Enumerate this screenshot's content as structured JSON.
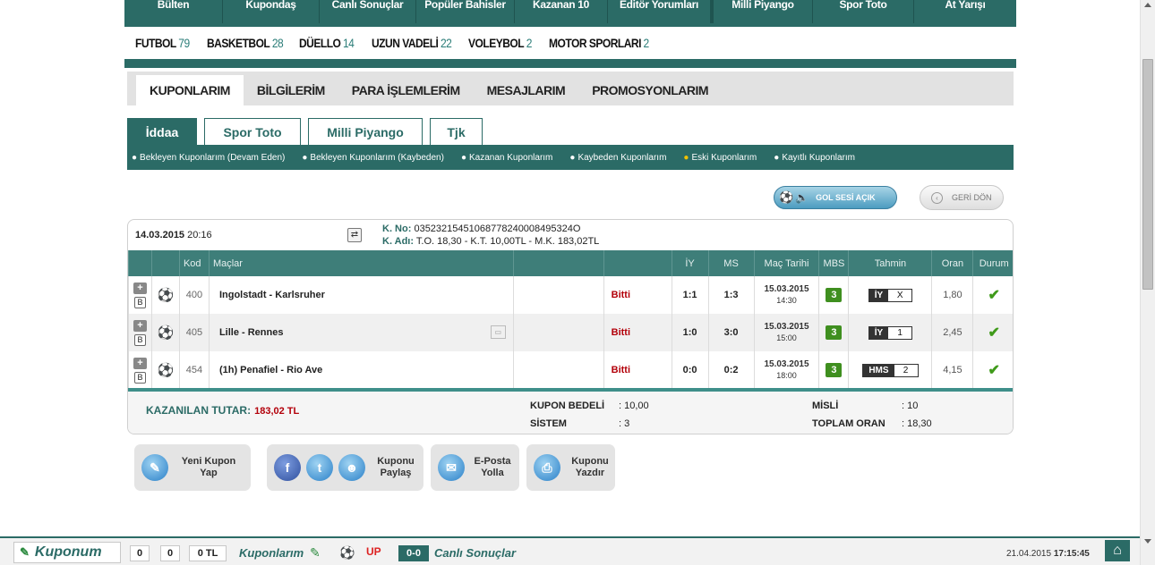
{
  "topnav": [
    "Bülten",
    "Kupondaş",
    "Canlı Sonuçlar",
    "Popüler Bahisler",
    "Kazanan 10",
    "Editör Yorumları",
    "Milli Piyango",
    "Spor Toto",
    "At Yarışı"
  ],
  "sports": [
    {
      "name": "FUTBOL",
      "count": "79"
    },
    {
      "name": "BASKETBOL",
      "count": "28"
    },
    {
      "name": "DÜELLO",
      "count": "14"
    },
    {
      "name": "UZUN VADELİ",
      "count": "22"
    },
    {
      "name": "VOLEYBOL",
      "count": "2"
    },
    {
      "name": "MOTOR SPORLARI",
      "count": "2"
    }
  ],
  "account_tabs": [
    "KUPONLARIM",
    "BİLGİLERİM",
    "PARA İŞLEMLERİM",
    "MESAJLARIM",
    "PROMOSYONLARIM"
  ],
  "game_tabs": [
    "İddaa",
    "Spor Toto",
    "Milli Piyango",
    "Tjk"
  ],
  "filters": [
    "Bekleyen Kuponlarım (Devam Eden)",
    "Bekleyen Kuponlarım (Kaybeden)",
    "Kazanan Kuponlarım",
    "Kaybeden Kuponlarım",
    "Eski Kuponlarım",
    "Kayıtlı Kuponlarım"
  ],
  "buttons": {
    "gol_sesi": "GOL SESİ AÇIK",
    "geri_don": "GERİ DÖN"
  },
  "coupon": {
    "date": "14.03.2015",
    "time": "20:16",
    "k_no_label": "K. No:",
    "k_no": "03523215451068778240008495324O",
    "k_adi_label": "K. Adı:",
    "k_adi": "T.O. 18,30 - K.T. 10,00TL - M.K. 183,02TL"
  },
  "table_headers": [
    "",
    "",
    "Kod",
    "Maçlar",
    "",
    "",
    "İY",
    "MS",
    "Maç Tarihi",
    "MBS",
    "Tahmin",
    "Oran",
    "Durum"
  ],
  "matches": [
    {
      "kod": "400",
      "mac": "Ingolstadt - Karlsruher",
      "status": "Bitti",
      "iy": "1:1",
      "ms": "1:3",
      "date": "15.03.2015",
      "time": "14:30",
      "mbs": "3",
      "tahmin_type": "İY",
      "tahmin_val": "X",
      "oran": "1,80"
    },
    {
      "kod": "405",
      "mac": "Lille - Rennes",
      "status": "Bitti",
      "iy": "1:0",
      "ms": "3:0",
      "date": "15.03.2015",
      "time": "15:00",
      "mbs": "3",
      "tahmin_type": "İY",
      "tahmin_val": "1",
      "oran": "2,45"
    },
    {
      "kod": "454",
      "mac": "(1h) Penafiel - Rio Ave",
      "status": "Bitti",
      "iy": "0:0",
      "ms": "0:2",
      "date": "15.03.2015",
      "time": "18:00",
      "mbs": "3",
      "tahmin_type": "HMS",
      "tahmin_val": "2",
      "oran": "4,15"
    }
  ],
  "summary": {
    "kazanilan_label": "KAZANILAN TUTAR:",
    "kazanilan": "183,02 TL",
    "kupon_bedeli_label": "KUPON BEDELİ",
    "kupon_bedeli": "10,00",
    "sistem_label": "SİSTEM",
    "sistem": "3",
    "misli_label": "MİSLİ",
    "misli": "10",
    "toplam_oran_label": "TOPLAM ORAN",
    "toplam_oran": "18,30",
    "colon": ":"
  },
  "actions": {
    "yeni_kupon": "Yeni Kupon Yap",
    "paylas": "Kuponu Paylaş",
    "eposta": "E-Posta Yolla",
    "yazdir": "Kuponu Yazdır"
  },
  "bottombar": {
    "kuponum": "Kuponum",
    "count1": "0",
    "count2": "0",
    "amount": "0 TL",
    "kuponlarim": "Kuponlarım",
    "canli_icon": "0-0",
    "canli": "Canlı Sonuçlar",
    "date": "21.04.2015",
    "time": "17:15:45"
  },
  "colors": {
    "brand": "#2b6b66",
    "win": "#3f9a1a",
    "status": "#b3000a"
  }
}
